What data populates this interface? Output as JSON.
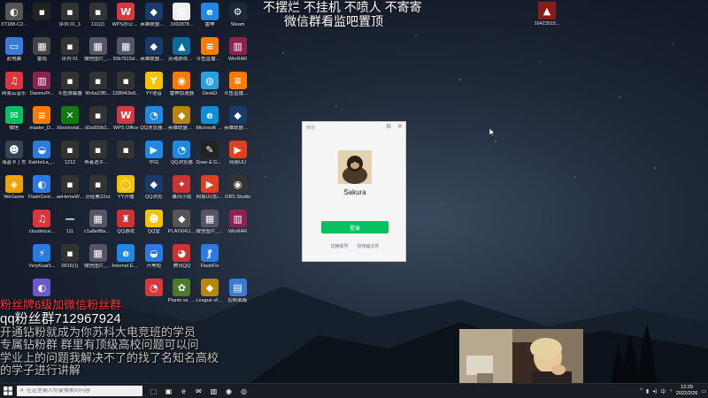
{
  "desktop": {
    "icons": [
      {
        "label": "XT188-C2...",
        "glyph": "◐",
        "color": "#555"
      },
      {
        "label": "",
        "glyph": "▪",
        "color": "#222"
      },
      {
        "label": "序列 01_1",
        "glyph": "▪",
        "color": "#333"
      },
      {
        "label": "111(2)",
        "glyph": "▪",
        "color": "#333"
      },
      {
        "label": "WPS办公助手",
        "glyph": "W",
        "color": "#d9363e"
      },
      {
        "label": "英雄联盟WeGame版",
        "glyph": "◆",
        "color": "#1a3a6a"
      },
      {
        "label": "1002878...",
        "glyph": "▤",
        "color": "#eee"
      },
      {
        "label": "雷神",
        "glyph": "e",
        "color": "#1e88e5"
      },
      {
        "label": "Steam",
        "glyph": "⚙",
        "color": "#1b2838"
      },
      {
        "label": "此电脑",
        "glyph": "▭",
        "color": "#3a7bd5"
      },
      {
        "label": "雷雨",
        "glyph": "▦",
        "color": "#444"
      },
      {
        "label": "序列 01",
        "glyph": "▪",
        "color": "#333"
      },
      {
        "label": "微信图片_2021102...",
        "glyph": "▦",
        "color": "#556"
      },
      {
        "label": "90b7615d...",
        "glyph": "▦",
        "color": "#556"
      },
      {
        "label": "英雄联盟WeGame版",
        "glyph": "◆",
        "color": "#1a3a6a"
      },
      {
        "label": "灵魂游戏加速器",
        "glyph": "▲",
        "color": "#0a6a9a"
      },
      {
        "label": "斗鱼直播助手",
        "glyph": "≡",
        "color": "#ff7b00"
      },
      {
        "label": "WinRAR",
        "glyph": "▥",
        "color": "#8b2252"
      },
      {
        "label": "网易云音乐",
        "glyph": "♫",
        "color": "#d9363e"
      },
      {
        "label": "DanmuPr...",
        "glyph": "▥",
        "color": "#8b2252"
      },
      {
        "label": "斗鱼弹幕器",
        "glyph": "▪",
        "color": "#333"
      },
      {
        "label": "9fc6a23f5...",
        "glyph": "▪",
        "color": "#333"
      },
      {
        "label": "1285f43e8...",
        "glyph": "▪",
        "color": "#333"
      },
      {
        "label": "YY语音",
        "glyph": "Y",
        "color": "#f5c400"
      },
      {
        "label": "雷神加速器",
        "glyph": "◉",
        "color": "#ff7b00"
      },
      {
        "label": "DeskD",
        "glyph": "◍",
        "color": "#2aa0e0"
      },
      {
        "label": "斗鱼直播伴侣",
        "glyph": "≡",
        "color": "#ff7b00"
      },
      {
        "label": "微信",
        "glyph": "✉",
        "color": "#07c160"
      },
      {
        "label": "master_D...",
        "glyph": "≡",
        "color": "#ff7b00"
      },
      {
        "label": "XboxInstal...",
        "glyph": "✕",
        "color": "#107c10"
      },
      {
        "label": "d2a950b2...",
        "glyph": "▪",
        "color": "#333"
      },
      {
        "label": "WPS Office",
        "glyph": "W",
        "color": "#d9363e"
      },
      {
        "label": "QQ浏览器(2)",
        "glyph": "◔",
        "color": "#1e88e5"
      },
      {
        "label": "英雄联盟游戏",
        "glyph": "◆",
        "color": "#b8860b"
      },
      {
        "label": "Microsoft Edge",
        "glyph": "e",
        "color": "#0c8ed9"
      },
      {
        "label": "英雄联盟WeGame版",
        "glyph": "◆",
        "color": "#1a3a6a"
      },
      {
        "label": "海盗卡丁车",
        "glyph": "☻",
        "color": "#345"
      },
      {
        "label": "KaiHeiLa_...",
        "glyph": "◒",
        "color": "#2a7ae2"
      },
      {
        "label": "1212",
        "glyph": "▪",
        "color": "#333"
      },
      {
        "label": "再者选手用这个电住你的...",
        "glyph": "▪",
        "color": "#333"
      },
      {
        "label": "",
        "glyph": "▪",
        "color": "#333"
      },
      {
        "label": "中目",
        "glyph": "▶",
        "color": "#1e88e5"
      },
      {
        "label": "QQ浏览器",
        "glyph": "◔",
        "color": "#1e88e5"
      },
      {
        "label": "Draw & Guess",
        "glyph": "✎",
        "color": "#222"
      },
      {
        "label": "网易UU",
        "glyph": "▶",
        "color": "#e04020"
      },
      {
        "label": "WeGame",
        "glyph": "◈",
        "color": "#f0a000"
      },
      {
        "label": "FlashCente...",
        "glyph": "◐",
        "color": "#2a7ae2"
      },
      {
        "label": "aeHemeW...",
        "glyph": "▪",
        "color": "#333"
      },
      {
        "label": "历经累22zz",
        "glyph": "▪",
        "color": "#333"
      },
      {
        "label": "YY开播",
        "glyph": "◯",
        "color": "#f5c400"
      },
      {
        "label": "QQ浏览",
        "glyph": "◆",
        "color": "#1a3a6a"
      },
      {
        "label": "暴风小雨",
        "glyph": "✦",
        "color": "#c33"
      },
      {
        "label": "网易UU加速器",
        "glyph": "▶",
        "color": "#e04020"
      },
      {
        "label": "OBS Studio",
        "glyph": "◉",
        "color": "#333"
      },
      {
        "label": "",
        "glyph": "",
        "color": "transparent"
      },
      {
        "label": "cloudmusi...",
        "glyph": "♫",
        "color": "#d9363e"
      },
      {
        "label": "111",
        "glyph": "—",
        "color": "transparent"
      },
      {
        "label": "c1a8e88ae...",
        "glyph": "▦",
        "color": "#556"
      },
      {
        "label": "QQ游戏",
        "glyph": "♜",
        "color": "#c33"
      },
      {
        "label": "QQ堂",
        "glyph": "☻",
        "color": "#f5c400"
      },
      {
        "label": "PLAYERU... BATTLEGR...",
        "glyph": "◆",
        "color": "#555"
      },
      {
        "label": "微信图片_2022011...",
        "glyph": "▦",
        "color": "#556"
      },
      {
        "label": "WinRAR",
        "glyph": "▥",
        "color": "#8b2252"
      },
      {
        "label": "",
        "glyph": "",
        "color": "transparent"
      },
      {
        "label": "VeryKuaiS...",
        "glyph": "⚡",
        "color": "#2a7ae2"
      },
      {
        "label": "0916(1)",
        "glyph": "▪",
        "color": "#333"
      },
      {
        "label": "微信图片_2021111...",
        "glyph": "▦",
        "color": "#556"
      },
      {
        "label": "Internet Explorer",
        "glyph": "e",
        "color": "#1e88e5"
      },
      {
        "label": "开黑啦",
        "glyph": "◒",
        "color": "#2a7ae2"
      },
      {
        "label": "腾讯QQ",
        "glyph": "◕",
        "color": "#c33"
      },
      {
        "label": "FlashFiv",
        "glyph": "ƒ",
        "color": "#2a7ae2"
      },
      {
        "label": "",
        "glyph": "",
        "color": "transparent"
      },
      {
        "label": "",
        "glyph": "",
        "color": "transparent"
      },
      {
        "label": "",
        "glyph": "◐",
        "color": "#6a5acd"
      },
      {
        "label": "",
        "glyph": "",
        "color": "transparent"
      },
      {
        "label": "",
        "glyph": "",
        "color": "transparent"
      },
      {
        "label": "",
        "glyph": "",
        "color": "transparent"
      },
      {
        "label": "",
        "glyph": "◔",
        "color": "#d9363e"
      },
      {
        "label": "Plants vs. Zombie...",
        "glyph": "✿",
        "color": "#4a7a2a"
      },
      {
        "label": "League of Legends",
        "glyph": "◆",
        "color": "#b8860b"
      },
      {
        "label": "控制面板",
        "glyph": "▤",
        "color": "#3a7bd5"
      },
      {
        "label": "",
        "glyph": "",
        "color": "transparent"
      }
    ],
    "top_right_icon": {
      "label": "16423515...",
      "glyph": "▲",
      "color": "#8b1a1a"
    }
  },
  "overlay": {
    "top_line1": "不摆烂 不挂机 不喷人 不寄寄",
    "top_line2": "微信群看监吧置顶",
    "left_line1": "粉丝牌6级加微信粉丝群",
    "left_line2": "qq粉丝群712967924",
    "left_line3": "开通钻粉就成为你苏科大电竞班的学员",
    "left_line4": "专属钻粉群 群里有顶级高校问题可以问",
    "left_line5": "学业上的问题我解决不了的找了名知名高校",
    "left_line6": "的学子进行讲解"
  },
  "dialog": {
    "app_name": "微信",
    "username": "Sakura",
    "login_label": "登录",
    "switch_account": "切换账号",
    "transfer_only": "仅传输文件"
  },
  "taskbar": {
    "search_placeholder": "在这里输入你要搜索的内容",
    "apps": [
      "⬚",
      "▣",
      "e",
      "✉",
      "▥",
      "◉",
      "◎"
    ],
    "time": "12:29",
    "date": "2022/2/26",
    "lang": "中"
  }
}
